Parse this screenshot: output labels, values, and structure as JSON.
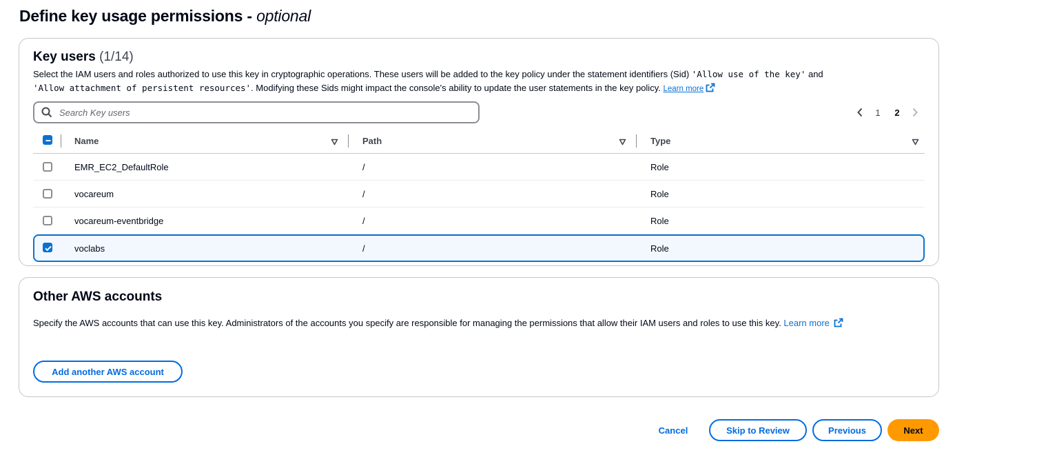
{
  "page": {
    "title": "Define key usage permissions -",
    "title_optional": "optional"
  },
  "key_users": {
    "title": "Key users",
    "count": "(1/14)",
    "description_part1": "Select the IAM users and roles authorized to use this key in cryptographic operations. These users will be added to the key policy under the statement identifiers (Sid) ",
    "sid1": "'Allow use of the key'",
    "description_and": " and",
    "sid2": "'Allow attachment of persistent resources'",
    "description_part2": ". Modifying these Sids might impact the console's ability to update the user statements in the key policy. ",
    "learn_more": "Learn more",
    "search_placeholder": "Search Key users",
    "pagination": {
      "pages": [
        "1",
        "2"
      ],
      "current_page": "2"
    },
    "columns": {
      "name": "Name",
      "path": "Path",
      "type": "Type"
    },
    "rows": [
      {
        "name": "EMR_EC2_DefaultRole",
        "path": "/",
        "type": "Role",
        "selected": false
      },
      {
        "name": "vocareum",
        "path": "/",
        "type": "Role",
        "selected": false
      },
      {
        "name": "vocareum-eventbridge",
        "path": "/",
        "type": "Role",
        "selected": false
      },
      {
        "name": "voclabs",
        "path": "/",
        "type": "Role",
        "selected": true
      }
    ]
  },
  "other_accounts": {
    "title": "Other AWS accounts",
    "description": "Specify the AWS accounts that can use this key. Administrators of the accounts you specify are responsible for managing the permissions that allow their IAM users and roles to use this key. ",
    "learn_more": "Learn more",
    "add_button": "Add another AWS account"
  },
  "footer": {
    "cancel": "Cancel",
    "skip": "Skip to Review",
    "previous": "Previous",
    "next": "Next"
  },
  "colors": {
    "accent": "#0972d3",
    "primary_button": "#ff9900",
    "selected_row_bg": "#f2f8fd"
  },
  "icons": [
    "search-icon",
    "external-link-icon",
    "chevron-left-icon",
    "chevron-right-icon",
    "sort-caret-icon",
    "checkbox-indeterminate-icon",
    "checkbox-checked-icon"
  ]
}
